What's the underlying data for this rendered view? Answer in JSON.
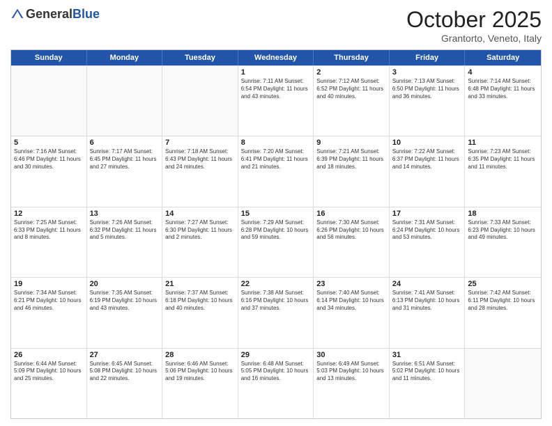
{
  "logo": {
    "general": "General",
    "blue": "Blue"
  },
  "header": {
    "title": "October 2025",
    "subtitle": "Grantorto, Veneto, Italy"
  },
  "days": [
    "Sunday",
    "Monday",
    "Tuesday",
    "Wednesday",
    "Thursday",
    "Friday",
    "Saturday"
  ],
  "weeks": [
    [
      {
        "day": "",
        "info": ""
      },
      {
        "day": "",
        "info": ""
      },
      {
        "day": "",
        "info": ""
      },
      {
        "day": "1",
        "info": "Sunrise: 7:11 AM\nSunset: 6:54 PM\nDaylight: 11 hours and 43 minutes."
      },
      {
        "day": "2",
        "info": "Sunrise: 7:12 AM\nSunset: 6:52 PM\nDaylight: 11 hours and 40 minutes."
      },
      {
        "day": "3",
        "info": "Sunrise: 7:13 AM\nSunset: 6:50 PM\nDaylight: 11 hours and 36 minutes."
      },
      {
        "day": "4",
        "info": "Sunrise: 7:14 AM\nSunset: 6:48 PM\nDaylight: 11 hours and 33 minutes."
      }
    ],
    [
      {
        "day": "5",
        "info": "Sunrise: 7:16 AM\nSunset: 6:46 PM\nDaylight: 11 hours and 30 minutes."
      },
      {
        "day": "6",
        "info": "Sunrise: 7:17 AM\nSunset: 6:45 PM\nDaylight: 11 hours and 27 minutes."
      },
      {
        "day": "7",
        "info": "Sunrise: 7:18 AM\nSunset: 6:43 PM\nDaylight: 11 hours and 24 minutes."
      },
      {
        "day": "8",
        "info": "Sunrise: 7:20 AM\nSunset: 6:41 PM\nDaylight: 11 hours and 21 minutes."
      },
      {
        "day": "9",
        "info": "Sunrise: 7:21 AM\nSunset: 6:39 PM\nDaylight: 11 hours and 18 minutes."
      },
      {
        "day": "10",
        "info": "Sunrise: 7:22 AM\nSunset: 6:37 PM\nDaylight: 11 hours and 14 minutes."
      },
      {
        "day": "11",
        "info": "Sunrise: 7:23 AM\nSunset: 6:35 PM\nDaylight: 11 hours and 11 minutes."
      }
    ],
    [
      {
        "day": "12",
        "info": "Sunrise: 7:25 AM\nSunset: 6:33 PM\nDaylight: 11 hours and 8 minutes."
      },
      {
        "day": "13",
        "info": "Sunrise: 7:26 AM\nSunset: 6:32 PM\nDaylight: 11 hours and 5 minutes."
      },
      {
        "day": "14",
        "info": "Sunrise: 7:27 AM\nSunset: 6:30 PM\nDaylight: 11 hours and 2 minutes."
      },
      {
        "day": "15",
        "info": "Sunrise: 7:29 AM\nSunset: 6:28 PM\nDaylight: 10 hours and 59 minutes."
      },
      {
        "day": "16",
        "info": "Sunrise: 7:30 AM\nSunset: 6:26 PM\nDaylight: 10 hours and 56 minutes."
      },
      {
        "day": "17",
        "info": "Sunrise: 7:31 AM\nSunset: 6:24 PM\nDaylight: 10 hours and 53 minutes."
      },
      {
        "day": "18",
        "info": "Sunrise: 7:33 AM\nSunset: 6:23 PM\nDaylight: 10 hours and 49 minutes."
      }
    ],
    [
      {
        "day": "19",
        "info": "Sunrise: 7:34 AM\nSunset: 6:21 PM\nDaylight: 10 hours and 46 minutes."
      },
      {
        "day": "20",
        "info": "Sunrise: 7:35 AM\nSunset: 6:19 PM\nDaylight: 10 hours and 43 minutes."
      },
      {
        "day": "21",
        "info": "Sunrise: 7:37 AM\nSunset: 6:18 PM\nDaylight: 10 hours and 40 minutes."
      },
      {
        "day": "22",
        "info": "Sunrise: 7:38 AM\nSunset: 6:16 PM\nDaylight: 10 hours and 37 minutes."
      },
      {
        "day": "23",
        "info": "Sunrise: 7:40 AM\nSunset: 6:14 PM\nDaylight: 10 hours and 34 minutes."
      },
      {
        "day": "24",
        "info": "Sunrise: 7:41 AM\nSunset: 6:13 PM\nDaylight: 10 hours and 31 minutes."
      },
      {
        "day": "25",
        "info": "Sunrise: 7:42 AM\nSunset: 6:11 PM\nDaylight: 10 hours and 28 minutes."
      }
    ],
    [
      {
        "day": "26",
        "info": "Sunrise: 6:44 AM\nSunset: 5:09 PM\nDaylight: 10 hours and 25 minutes."
      },
      {
        "day": "27",
        "info": "Sunrise: 6:45 AM\nSunset: 5:08 PM\nDaylight: 10 hours and 22 minutes."
      },
      {
        "day": "28",
        "info": "Sunrise: 6:46 AM\nSunset: 5:06 PM\nDaylight: 10 hours and 19 minutes."
      },
      {
        "day": "29",
        "info": "Sunrise: 6:48 AM\nSunset: 5:05 PM\nDaylight: 10 hours and 16 minutes."
      },
      {
        "day": "30",
        "info": "Sunrise: 6:49 AM\nSunset: 5:03 PM\nDaylight: 10 hours and 13 minutes."
      },
      {
        "day": "31",
        "info": "Sunrise: 6:51 AM\nSunset: 5:02 PM\nDaylight: 10 hours and 11 minutes."
      },
      {
        "day": "",
        "info": ""
      }
    ]
  ]
}
